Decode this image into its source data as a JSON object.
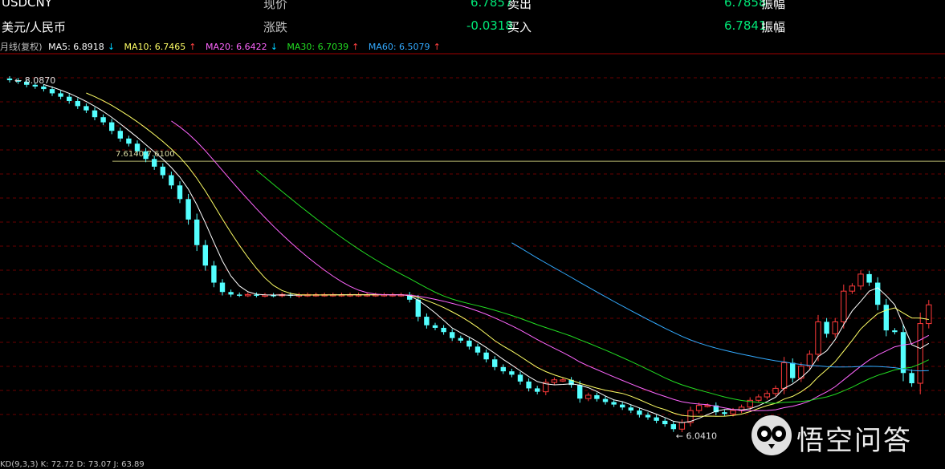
{
  "header": {
    "row1": {
      "symbol": "USDCNY",
      "field1_label": "现价",
      "field1_value": "6.7857",
      "field2_label": "卖出",
      "field2_value": "6.7858",
      "field3_label": "振幅"
    },
    "row2": {
      "symbol": "美元/人民币",
      "field1_label": "涨跌",
      "field1_value": "-0.0318",
      "field2_label": "买入",
      "field2_value": "6.7841",
      "field3_label": "振幅"
    }
  },
  "ma_legend": {
    "period": "月线(复权)",
    "items": [
      {
        "label": "MA5: 6.8918",
        "arrow": "↓",
        "color": "#ffffff",
        "dir": "down"
      },
      {
        "label": "MA10: 6.7465",
        "arrow": "↑",
        "color": "#ffff66",
        "dir": "up"
      },
      {
        "label": "MA20: 6.6422",
        "arrow": "↓",
        "color": "#ff66ff",
        "dir": "down"
      },
      {
        "label": "MA30: 6.7039",
        "arrow": "↑",
        "color": "#22dd22",
        "dir": "up"
      },
      {
        "label": "MA60: 6.5079",
        "arrow": "↑",
        "color": "#33aaff",
        "dir": "up"
      }
    ]
  },
  "chart_data": {
    "type": "candlestick",
    "ylim": [
      5.92,
      8.2
    ],
    "n_periods": 109,
    "annotations": {
      "high_label": "8.0870",
      "low_label": "6.0410",
      "range_label": "7.6140-7.6100",
      "range_value": 7.612
    },
    "close": [
      8.087,
      8.078,
      8.06,
      8.05,
      8.035,
      8.01,
      7.99,
      7.965,
      7.935,
      7.91,
      7.87,
      7.84,
      7.79,
      7.745,
      7.715,
      7.67,
      7.625,
      7.58,
      7.53,
      7.47,
      7.39,
      7.27,
      7.12,
      7.0,
      6.9,
      6.845,
      6.83,
      6.828,
      6.83,
      6.826,
      6.827,
      6.826,
      6.83,
      6.823,
      6.828,
      6.829,
      6.829,
      6.829,
      6.829,
      6.829,
      6.829,
      6.829,
      6.829,
      6.829,
      6.829,
      6.829,
      6.829,
      6.8,
      6.7,
      6.65,
      6.635,
      6.61,
      6.575,
      6.56,
      6.525,
      6.49,
      6.45,
      6.405,
      6.38,
      6.36,
      6.32,
      6.28,
      6.26,
      6.315,
      6.33,
      6.33,
      6.3,
      6.22,
      6.24,
      6.218,
      6.2,
      6.185,
      6.168,
      6.15,
      6.125,
      6.11,
      6.09,
      6.07,
      6.041,
      6.08,
      6.15,
      6.18,
      6.18,
      6.14,
      6.13,
      6.15,
      6.17,
      6.21,
      6.23,
      6.25,
      6.28,
      6.43,
      6.34,
      6.41,
      6.48,
      6.67,
      6.6,
      6.67,
      6.85,
      6.88,
      6.95,
      6.9,
      6.77,
      6.62,
      6.61,
      6.37,
      6.31,
      6.66,
      6.77
    ]
  },
  "footer": {
    "text": "KD(9,3,3) K: 72.72  D: 73.07  J: 63.89"
  },
  "watermark": {
    "text": "悟空问答",
    "icon": "owl-logo-icon"
  }
}
